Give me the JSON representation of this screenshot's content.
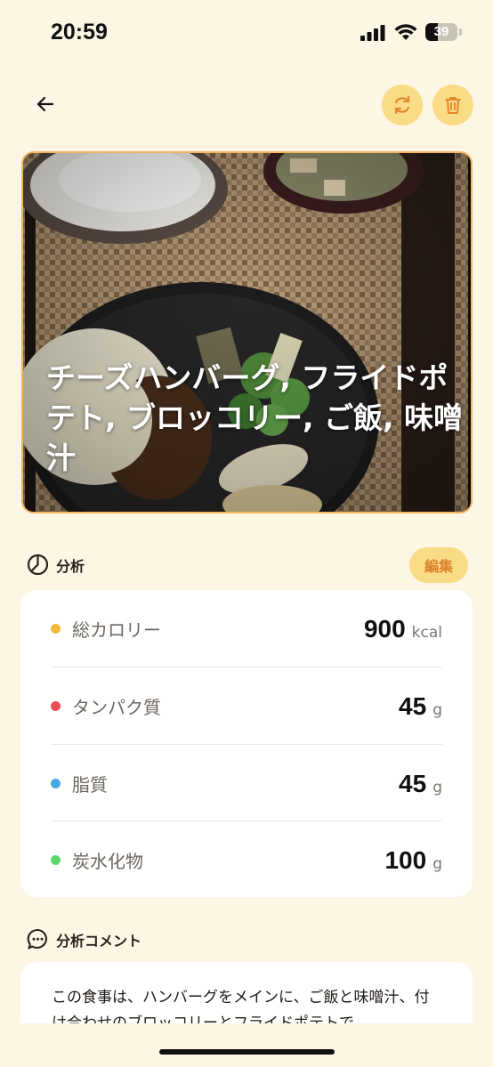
{
  "status_bar": {
    "time": "20:59",
    "battery": "39",
    "battery_level": 0.39
  },
  "hero": {
    "title": "チーズハンバーグ, フライドポテト, ブロッコリー, ご飯, 味噌汁"
  },
  "analysis": {
    "label": "分析",
    "edit_label": "編集",
    "rows": [
      {
        "label": "総カロリー",
        "value": "900",
        "unit": "kcal",
        "color": "#f6b73c"
      },
      {
        "label": "タンパク質",
        "value": "45",
        "unit": "g",
        "color": "#ec4f58"
      },
      {
        "label": "脂質",
        "value": "45",
        "unit": "g",
        "color": "#4aa8e6"
      },
      {
        "label": "炭水化物",
        "value": "100",
        "unit": "g",
        "color": "#5fd66b"
      }
    ]
  },
  "comment": {
    "label": "分析コメント",
    "text": "この食事は、ハンバーグをメインに、ご飯と味噌汁、付け合わせのブロッコリーとフライドポテトで"
  },
  "icons": {
    "back": "arrow-left-icon",
    "refresh": "refresh-icon",
    "delete": "trash-icon",
    "analysis": "chart-pie-icon",
    "comment": "chat-bubble-icon"
  },
  "colors": {
    "background": "#fdf6e4",
    "accent": "#fadb86",
    "accent_text": "#d9822b",
    "hero_border": "#f3b45e"
  }
}
